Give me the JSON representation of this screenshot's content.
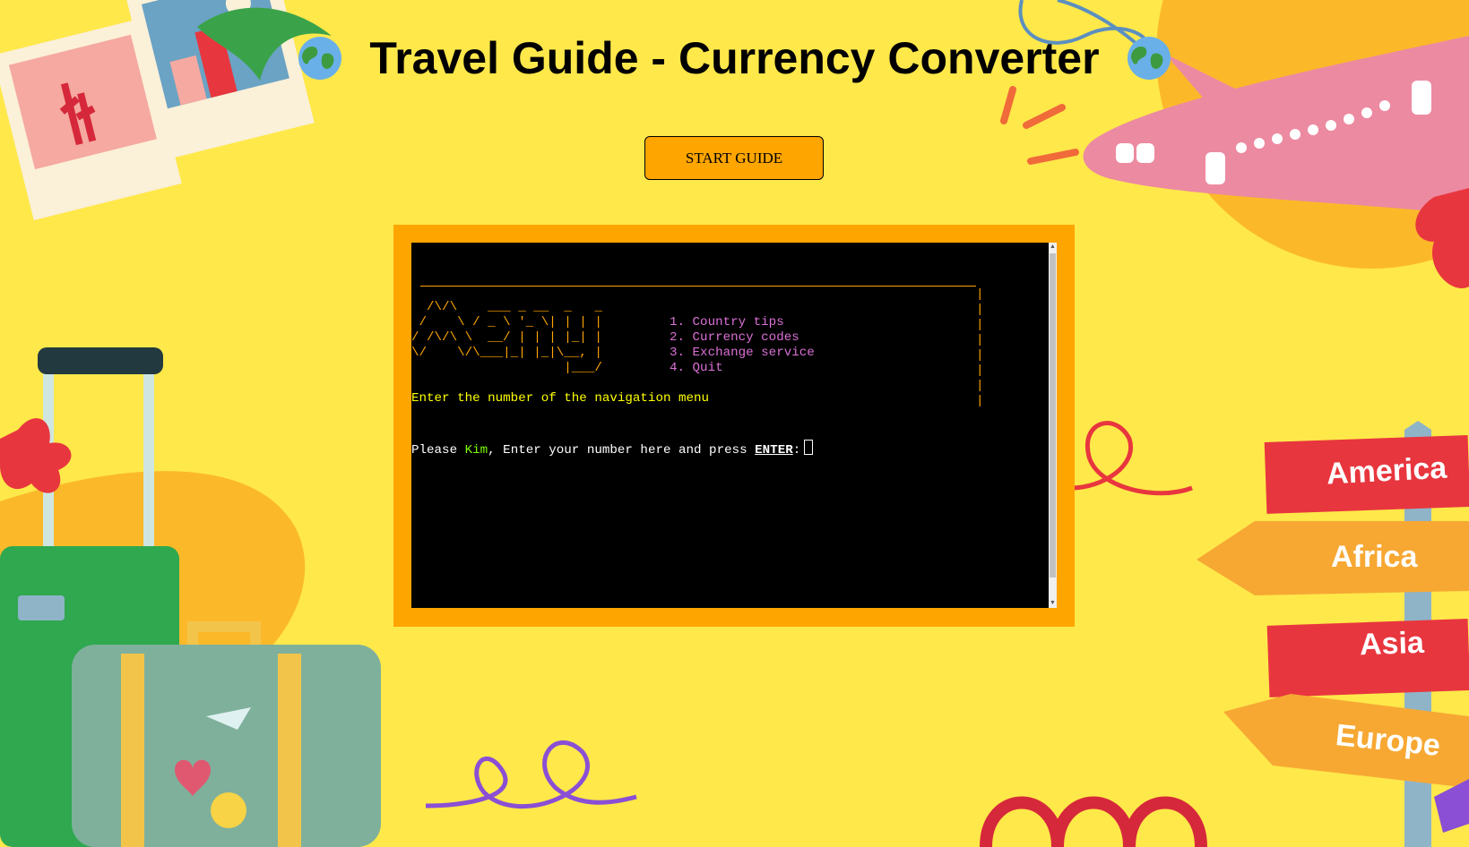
{
  "header": {
    "title": "Travel Guide - Currency Converter"
  },
  "start_button": {
    "label": "START GUIDE"
  },
  "terminal": {
    "logo_lines": [
      "  /\\/\\    ___ _ __  _   _ ",
      " /    \\ / _ \\ '_ \\| | | |",
      "/ /\\/\\ \\  __/ | | | |_| |",
      "\\/    \\/\\___|_| |_|\\__, |",
      "                    |___/ "
    ],
    "menu_items": [
      "1. Country tips",
      "2. Currency codes",
      "3. Exchange service",
      "4. Quit"
    ],
    "instruction": "Enter the number of the navigation menu",
    "prompt_prefix": "Please ",
    "user_name": "Kim",
    "prompt_middle": ", Enter your number here and press ",
    "prompt_key": "ENTER",
    "prompt_suffix": ":"
  },
  "signposts": [
    "America",
    "Africa",
    "Asia",
    "Europe"
  ],
  "colors": {
    "background": "#ffe84a",
    "accent": "#ffa500",
    "terminal_bg": "#000000",
    "menu_text": "#da70d6",
    "instruction_text": "#ffff00",
    "user_name": "#7cfc00"
  },
  "icons": [
    "globe-icon",
    "polaroid-photos",
    "airplane-illustration",
    "luggage-illustration",
    "signpost-illustration"
  ]
}
